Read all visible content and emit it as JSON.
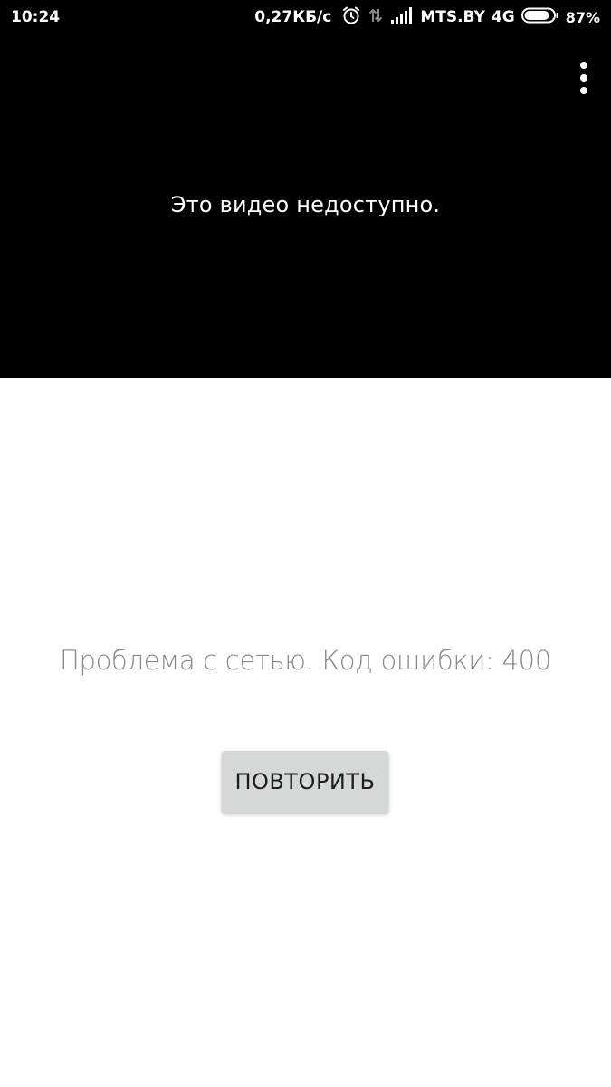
{
  "status_bar": {
    "time": "10:24",
    "net_speed": "0,27КБ/с",
    "carrier": "MTS.BY",
    "network_type": "4G",
    "battery_percent": "87%",
    "battery_level": 0.87,
    "icons": [
      "alarm-clock-icon",
      "data-transfer-icon",
      "signal-strength-icon",
      "battery-icon"
    ]
  },
  "player": {
    "message": "Это видео недоступно.",
    "menu_icon": "more-vertical-icon"
  },
  "error": {
    "message": "Проблема с сетью. Код ошибки: 400",
    "retry_label": "ПОВТОРИТЬ"
  },
  "colors": {
    "player_background": "#000000",
    "page_background": "#ffffff",
    "error_text": "#8a8a8a",
    "button_background": "#d6d7d7",
    "button_text": "#1d1d1d"
  }
}
